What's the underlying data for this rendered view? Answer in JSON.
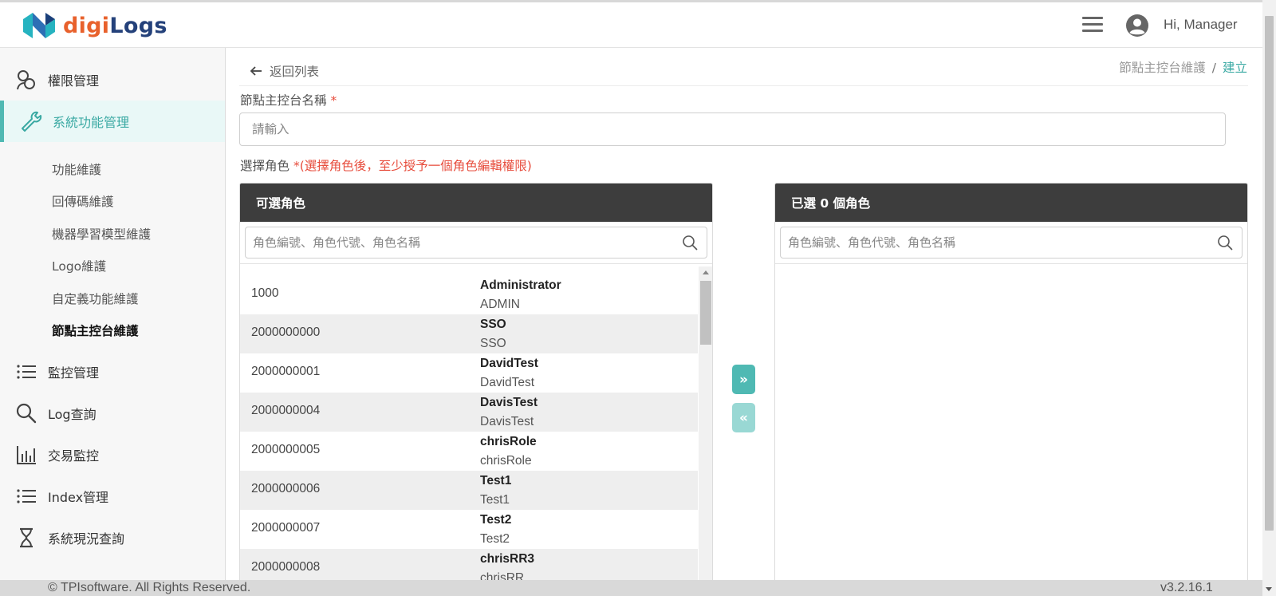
{
  "header": {
    "logo_digi": "digi",
    "logo_logs": "Logs",
    "greeting": "Hi, Manager",
    "menu_icon": "hamburger-menu-icon",
    "avatar_icon": "user-avatar-icon"
  },
  "sidebar": {
    "items": [
      {
        "label": "權限管理",
        "icon": "users-icon"
      },
      {
        "label": "系統功能管理",
        "icon": "wrench-icon"
      },
      {
        "label": "監控管理",
        "icon": "list-icon"
      },
      {
        "label": "Log查詢",
        "icon": "search-icon"
      },
      {
        "label": "交易監控",
        "icon": "bar-chart-icon"
      },
      {
        "label": "Index管理",
        "icon": "list-icon"
      },
      {
        "label": "系統現況查詢",
        "icon": "hourglass-icon"
      }
    ],
    "sub_items": [
      "功能維護",
      "回傳碼維護",
      "機器學習模型維護",
      "Logo維護",
      "自定義功能維護",
      "節點主控台維護"
    ]
  },
  "main": {
    "back_label": "返回列表",
    "breadcrumb": {
      "parent": "節點主控台維護",
      "separator": "/",
      "current": "建立"
    },
    "name_label": "節點主控台名稱",
    "required_mark": "*",
    "name_placeholder": "請輸入",
    "role_label": "選擇角色",
    "role_hint": "*(選擇角色後，至少授予一個角色編輯權限)"
  },
  "available": {
    "title": "可選角色",
    "search_placeholder": "角色編號、角色代號、角色名稱",
    "rows": [
      {
        "id": "1000",
        "name": "Administrator",
        "code": "ADMIN"
      },
      {
        "id": "2000000000",
        "name": "SSO",
        "code": "SSO"
      },
      {
        "id": "2000000001",
        "name": "DavidTest",
        "code": "DavidTest"
      },
      {
        "id": "2000000004",
        "name": "DavisTest",
        "code": "DavisTest"
      },
      {
        "id": "2000000005",
        "name": "chrisRole",
        "code": "chrisRole"
      },
      {
        "id": "2000000006",
        "name": "Test1",
        "code": "Test1"
      },
      {
        "id": "2000000007",
        "name": "Test2",
        "code": "Test2"
      },
      {
        "id": "2000000008",
        "name": "chrisRR3",
        "code": "chrisRR"
      }
    ]
  },
  "selected": {
    "title": "已選 0 個角色",
    "search_placeholder": "角色編號、角色代號、角色名稱"
  },
  "transfer": {
    "add": "»",
    "remove": "«"
  },
  "footer": {
    "copyright": "© TPIsoftware. All Rights Reserved.",
    "version": "v3.2.16.1"
  },
  "colors": {
    "accent": "#4fb9b3",
    "panel_header": "#3d3d3d",
    "required": "#e74c3c",
    "logo_orange": "#e8612c",
    "logo_navy": "#24417a"
  }
}
